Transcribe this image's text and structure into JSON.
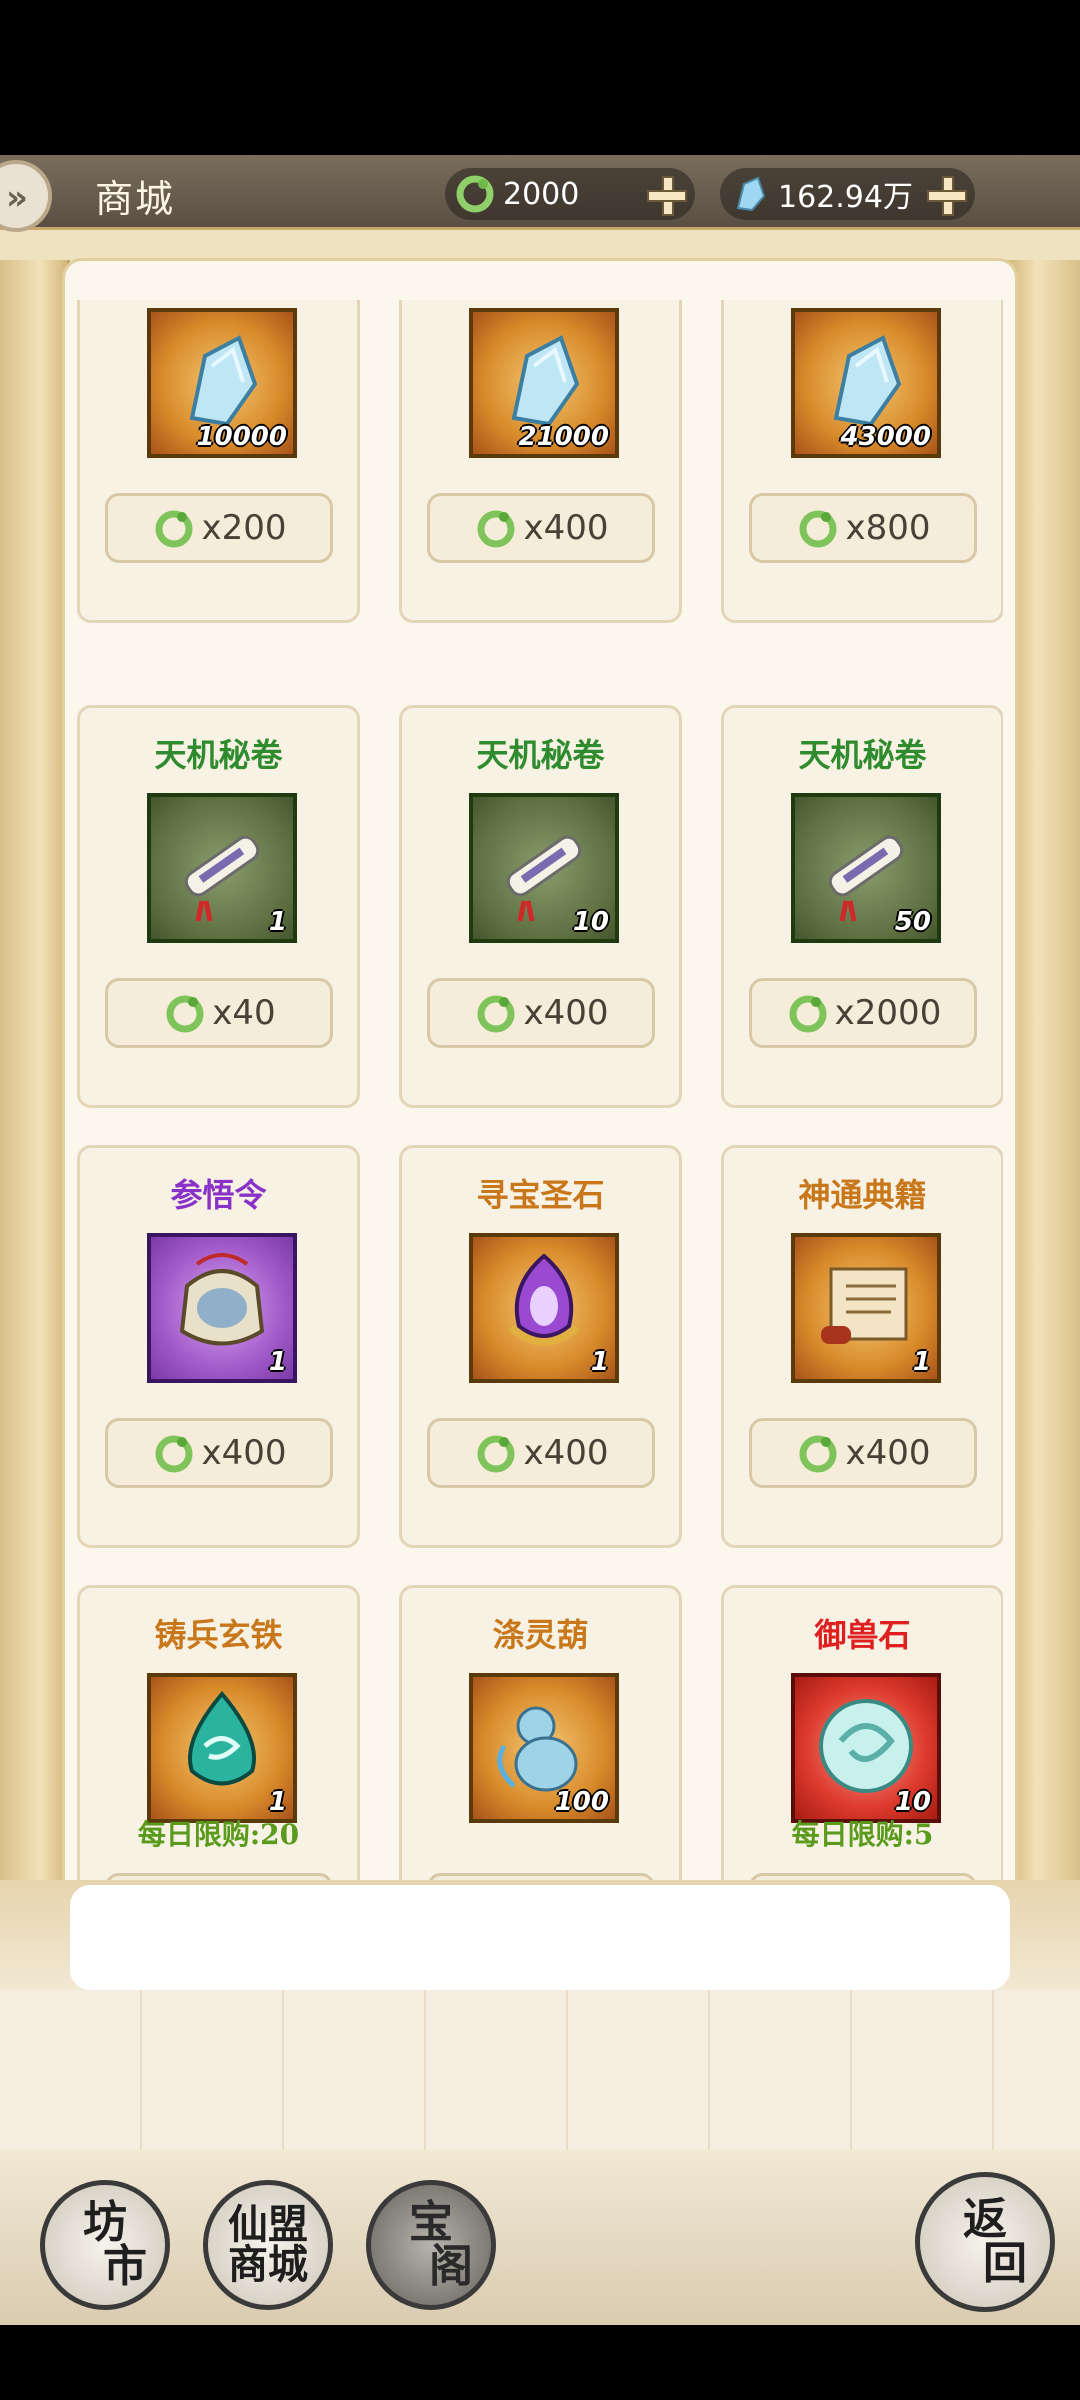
{
  "header": {
    "title": "商城",
    "currency": [
      {
        "icon": "jade-dragon-icon",
        "value": "2000"
      },
      {
        "icon": "spirit-crystal-icon",
        "value": "162.94万"
      }
    ]
  },
  "items": [
    {
      "name": "",
      "qty": "10000",
      "price": "x200",
      "frame": "orange",
      "icon": "crystal-icon",
      "limit": ""
    },
    {
      "name": "",
      "qty": "21000",
      "price": "x400",
      "frame": "orange",
      "icon": "crystal-icon",
      "limit": ""
    },
    {
      "name": "",
      "qty": "43000",
      "price": "x800",
      "frame": "orange",
      "icon": "crystal-icon",
      "limit": ""
    },
    {
      "name": "天机秘卷",
      "name_color": "#2e8b2e",
      "qty": "1",
      "price": "x40",
      "frame": "green",
      "icon": "scroll-icon",
      "limit": ""
    },
    {
      "name": "天机秘卷",
      "name_color": "#2e8b2e",
      "qty": "10",
      "price": "x400",
      "frame": "green",
      "icon": "scroll-icon",
      "limit": ""
    },
    {
      "name": "天机秘卷",
      "name_color": "#2e8b2e",
      "qty": "50",
      "price": "x2000",
      "frame": "green",
      "icon": "scroll-icon",
      "limit": ""
    },
    {
      "name": "参悟令",
      "name_color": "#8a32c8",
      "qty": "1",
      "price": "x400",
      "frame": "purple",
      "icon": "token-icon",
      "limit": ""
    },
    {
      "name": "寻宝圣石",
      "name_color": "#c8781a",
      "qty": "1",
      "price": "x400",
      "frame": "orange",
      "icon": "treasure-stone-icon",
      "limit": ""
    },
    {
      "name": "神通典籍",
      "name_color": "#c8781a",
      "qty": "1",
      "price": "x400",
      "frame": "orange",
      "icon": "book-scroll-icon",
      "limit": ""
    },
    {
      "name": "铸兵玄铁",
      "name_color": "#c8781a",
      "qty": "1",
      "price": "",
      "frame": "orange",
      "icon": "iron-ore-icon",
      "limit": "每日限购:20"
    },
    {
      "name": "涤灵葫",
      "name_color": "#c8781a",
      "qty": "100",
      "price": "",
      "frame": "orange",
      "icon": "gourd-icon",
      "limit": ""
    },
    {
      "name": "御兽石",
      "name_color": "#e02020",
      "qty": "10",
      "price": "",
      "frame": "red",
      "icon": "beast-stone-icon",
      "limit": "每日限购:5"
    }
  ],
  "nav": {
    "market": {
      "line1": "坊",
      "line2": "市"
    },
    "alliance_shop": {
      "line1": "仙盟",
      "line2": "商城"
    },
    "treasure": {
      "line1": "宝",
      "line2": "阁"
    },
    "back": {
      "line1": "返",
      "line2": "回"
    }
  }
}
